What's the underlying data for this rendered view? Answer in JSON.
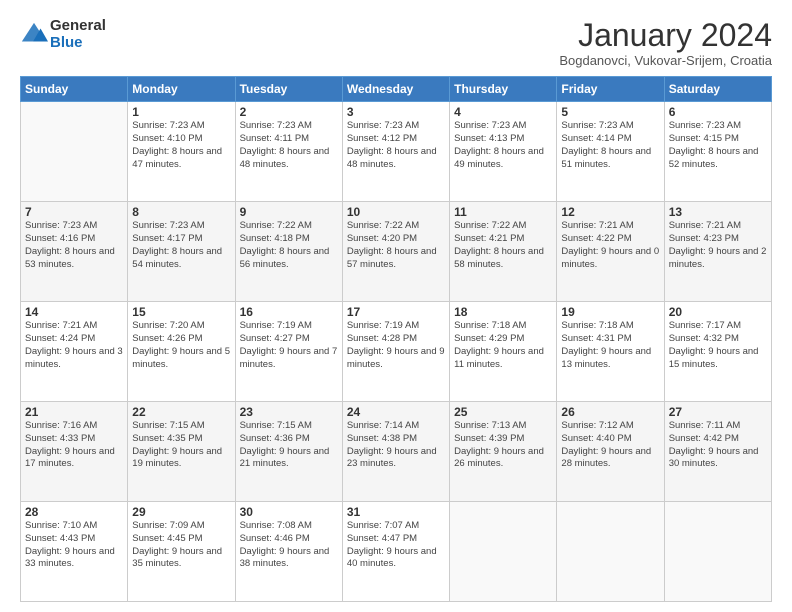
{
  "logo": {
    "general": "General",
    "blue": "Blue"
  },
  "header": {
    "title": "January 2024",
    "location": "Bogdanovci, Vukovar-Srijem, Croatia"
  },
  "weekdays": [
    "Sunday",
    "Monday",
    "Tuesday",
    "Wednesday",
    "Thursday",
    "Friday",
    "Saturday"
  ],
  "weeks": [
    [
      {
        "day": "",
        "sunrise": "",
        "sunset": "",
        "daylight": ""
      },
      {
        "day": "1",
        "sunrise": "Sunrise: 7:23 AM",
        "sunset": "Sunset: 4:10 PM",
        "daylight": "Daylight: 8 hours and 47 minutes."
      },
      {
        "day": "2",
        "sunrise": "Sunrise: 7:23 AM",
        "sunset": "Sunset: 4:11 PM",
        "daylight": "Daylight: 8 hours and 48 minutes."
      },
      {
        "day": "3",
        "sunrise": "Sunrise: 7:23 AM",
        "sunset": "Sunset: 4:12 PM",
        "daylight": "Daylight: 8 hours and 48 minutes."
      },
      {
        "day": "4",
        "sunrise": "Sunrise: 7:23 AM",
        "sunset": "Sunset: 4:13 PM",
        "daylight": "Daylight: 8 hours and 49 minutes."
      },
      {
        "day": "5",
        "sunrise": "Sunrise: 7:23 AM",
        "sunset": "Sunset: 4:14 PM",
        "daylight": "Daylight: 8 hours and 51 minutes."
      },
      {
        "day": "6",
        "sunrise": "Sunrise: 7:23 AM",
        "sunset": "Sunset: 4:15 PM",
        "daylight": "Daylight: 8 hours and 52 minutes."
      }
    ],
    [
      {
        "day": "7",
        "sunrise": "Sunrise: 7:23 AM",
        "sunset": "Sunset: 4:16 PM",
        "daylight": "Daylight: 8 hours and 53 minutes."
      },
      {
        "day": "8",
        "sunrise": "Sunrise: 7:23 AM",
        "sunset": "Sunset: 4:17 PM",
        "daylight": "Daylight: 8 hours and 54 minutes."
      },
      {
        "day": "9",
        "sunrise": "Sunrise: 7:22 AM",
        "sunset": "Sunset: 4:18 PM",
        "daylight": "Daylight: 8 hours and 56 minutes."
      },
      {
        "day": "10",
        "sunrise": "Sunrise: 7:22 AM",
        "sunset": "Sunset: 4:20 PM",
        "daylight": "Daylight: 8 hours and 57 minutes."
      },
      {
        "day": "11",
        "sunrise": "Sunrise: 7:22 AM",
        "sunset": "Sunset: 4:21 PM",
        "daylight": "Daylight: 8 hours and 58 minutes."
      },
      {
        "day": "12",
        "sunrise": "Sunrise: 7:21 AM",
        "sunset": "Sunset: 4:22 PM",
        "daylight": "Daylight: 9 hours and 0 minutes."
      },
      {
        "day": "13",
        "sunrise": "Sunrise: 7:21 AM",
        "sunset": "Sunset: 4:23 PM",
        "daylight": "Daylight: 9 hours and 2 minutes."
      }
    ],
    [
      {
        "day": "14",
        "sunrise": "Sunrise: 7:21 AM",
        "sunset": "Sunset: 4:24 PM",
        "daylight": "Daylight: 9 hours and 3 minutes."
      },
      {
        "day": "15",
        "sunrise": "Sunrise: 7:20 AM",
        "sunset": "Sunset: 4:26 PM",
        "daylight": "Daylight: 9 hours and 5 minutes."
      },
      {
        "day": "16",
        "sunrise": "Sunrise: 7:19 AM",
        "sunset": "Sunset: 4:27 PM",
        "daylight": "Daylight: 9 hours and 7 minutes."
      },
      {
        "day": "17",
        "sunrise": "Sunrise: 7:19 AM",
        "sunset": "Sunset: 4:28 PM",
        "daylight": "Daylight: 9 hours and 9 minutes."
      },
      {
        "day": "18",
        "sunrise": "Sunrise: 7:18 AM",
        "sunset": "Sunset: 4:29 PM",
        "daylight": "Daylight: 9 hours and 11 minutes."
      },
      {
        "day": "19",
        "sunrise": "Sunrise: 7:18 AM",
        "sunset": "Sunset: 4:31 PM",
        "daylight": "Daylight: 9 hours and 13 minutes."
      },
      {
        "day": "20",
        "sunrise": "Sunrise: 7:17 AM",
        "sunset": "Sunset: 4:32 PM",
        "daylight": "Daylight: 9 hours and 15 minutes."
      }
    ],
    [
      {
        "day": "21",
        "sunrise": "Sunrise: 7:16 AM",
        "sunset": "Sunset: 4:33 PM",
        "daylight": "Daylight: 9 hours and 17 minutes."
      },
      {
        "day": "22",
        "sunrise": "Sunrise: 7:15 AM",
        "sunset": "Sunset: 4:35 PM",
        "daylight": "Daylight: 9 hours and 19 minutes."
      },
      {
        "day": "23",
        "sunrise": "Sunrise: 7:15 AM",
        "sunset": "Sunset: 4:36 PM",
        "daylight": "Daylight: 9 hours and 21 minutes."
      },
      {
        "day": "24",
        "sunrise": "Sunrise: 7:14 AM",
        "sunset": "Sunset: 4:38 PM",
        "daylight": "Daylight: 9 hours and 23 minutes."
      },
      {
        "day": "25",
        "sunrise": "Sunrise: 7:13 AM",
        "sunset": "Sunset: 4:39 PM",
        "daylight": "Daylight: 9 hours and 26 minutes."
      },
      {
        "day": "26",
        "sunrise": "Sunrise: 7:12 AM",
        "sunset": "Sunset: 4:40 PM",
        "daylight": "Daylight: 9 hours and 28 minutes."
      },
      {
        "day": "27",
        "sunrise": "Sunrise: 7:11 AM",
        "sunset": "Sunset: 4:42 PM",
        "daylight": "Daylight: 9 hours and 30 minutes."
      }
    ],
    [
      {
        "day": "28",
        "sunrise": "Sunrise: 7:10 AM",
        "sunset": "Sunset: 4:43 PM",
        "daylight": "Daylight: 9 hours and 33 minutes."
      },
      {
        "day": "29",
        "sunrise": "Sunrise: 7:09 AM",
        "sunset": "Sunset: 4:45 PM",
        "daylight": "Daylight: 9 hours and 35 minutes."
      },
      {
        "day": "30",
        "sunrise": "Sunrise: 7:08 AM",
        "sunset": "Sunset: 4:46 PM",
        "daylight": "Daylight: 9 hours and 38 minutes."
      },
      {
        "day": "31",
        "sunrise": "Sunrise: 7:07 AM",
        "sunset": "Sunset: 4:47 PM",
        "daylight": "Daylight: 9 hours and 40 minutes."
      },
      {
        "day": "",
        "sunrise": "",
        "sunset": "",
        "daylight": ""
      },
      {
        "day": "",
        "sunrise": "",
        "sunset": "",
        "daylight": ""
      },
      {
        "day": "",
        "sunrise": "",
        "sunset": "",
        "daylight": ""
      }
    ]
  ]
}
